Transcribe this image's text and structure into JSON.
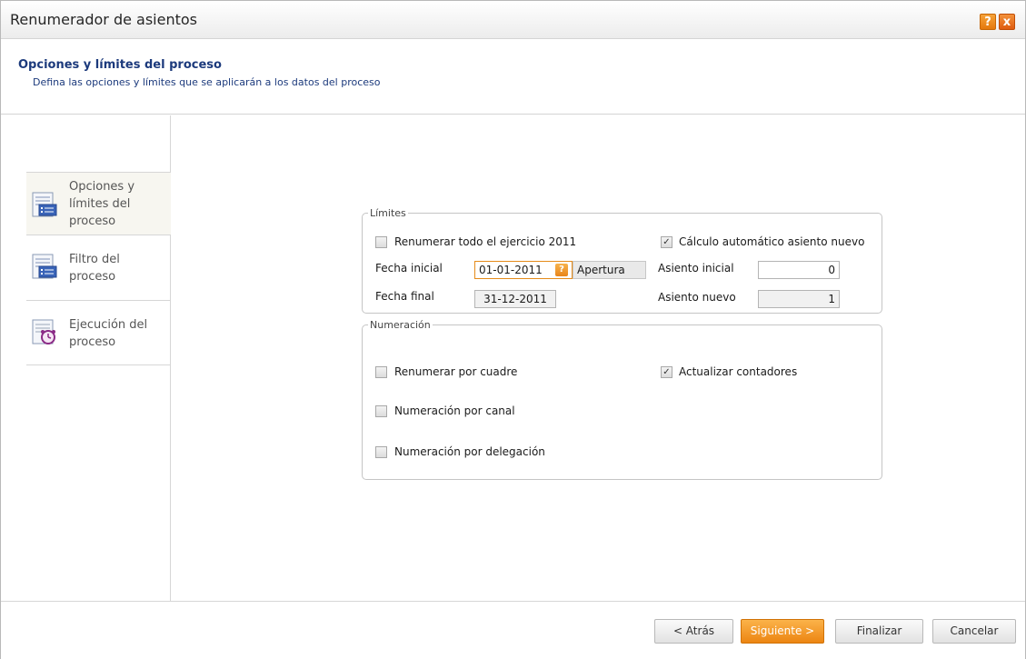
{
  "window": {
    "title": "Renumerador de asientos",
    "help_icon": "?",
    "close_icon": "x"
  },
  "header": {
    "title": "Opciones y límites del proceso",
    "subtitle": "Defina las opciones y límites que se aplicarán a los datos del proceso"
  },
  "sidebar": {
    "items": [
      {
        "label": "Opciones y\nlímites del\nproceso",
        "icon": "form-list-icon",
        "active": true
      },
      {
        "label": "Filtro del\nproceso",
        "icon": "form-list-icon",
        "active": false
      },
      {
        "label": "Ejecución del\nproceso",
        "icon": "alarm-clock-icon",
        "active": false
      }
    ]
  },
  "limites": {
    "legend": "Límites",
    "renumerar_todo_label": "Renumerar todo el ejercicio 2011",
    "renumerar_todo_checked": false,
    "calculo_auto_label": "Cálculo automático asiento nuevo",
    "calculo_auto_checked": true,
    "fecha_inicial_label": "Fecha inicial",
    "fecha_inicial_value": "01-01-2011",
    "fecha_inicial_tag": "Apertura",
    "fecha_final_label": "Fecha final",
    "fecha_final_value": "31-12-2011",
    "asiento_inicial_label": "Asiento inicial",
    "asiento_inicial_value": "0",
    "asiento_nuevo_label": "Asiento nuevo",
    "asiento_nuevo_value": "1"
  },
  "numeracion": {
    "legend": "Numeración",
    "renumerar_cuadre_label": "Renumerar por cuadre",
    "renumerar_cuadre_checked": false,
    "actualizar_contadores_label": "Actualizar contadores",
    "actualizar_contadores_checked": true,
    "numeracion_canal_label": "Numeración por canal",
    "numeracion_canal_checked": false,
    "numeracion_delegacion_label": "Numeración por delegación",
    "numeracion_delegacion_checked": false
  },
  "footer": {
    "atras_label": "< Atrás",
    "siguiente_label": "Siguiente >",
    "finalizar_label": "Finalizar",
    "cancelar_label": "Cancelar"
  },
  "colors": {
    "accent": "#ec8512",
    "header_text": "#1c3a7c"
  }
}
